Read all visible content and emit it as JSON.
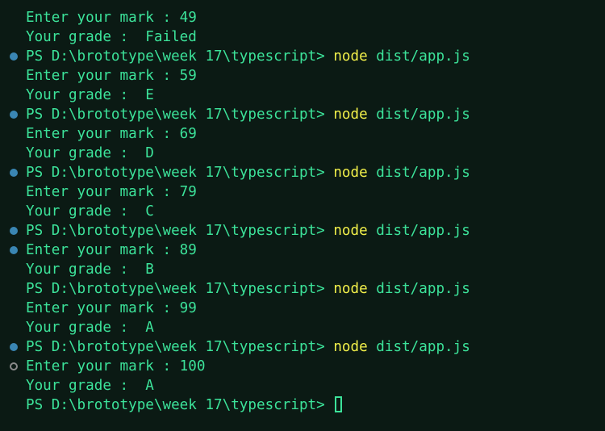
{
  "terminal": {
    "prompt": "PS D:\\brototype\\week 17\\typescript> ",
    "command": "node",
    "args": " dist/app.js",
    "lines": [
      {
        "kind": "output",
        "dot": "none",
        "text": "Enter your mark : 49"
      },
      {
        "kind": "output",
        "dot": "none",
        "text": "Your grade :  Failed"
      },
      {
        "kind": "prompt",
        "dot": "filled"
      },
      {
        "kind": "output",
        "dot": "none",
        "text": "Enter your mark : 59"
      },
      {
        "kind": "output",
        "dot": "none",
        "text": "Your grade :  E"
      },
      {
        "kind": "prompt",
        "dot": "filled"
      },
      {
        "kind": "output",
        "dot": "none",
        "text": "Enter your mark : 69"
      },
      {
        "kind": "output",
        "dot": "none",
        "text": "Your grade :  D"
      },
      {
        "kind": "prompt",
        "dot": "filled"
      },
      {
        "kind": "output",
        "dot": "none",
        "text": "Enter your mark : 79"
      },
      {
        "kind": "output",
        "dot": "none",
        "text": "Your grade :  C"
      },
      {
        "kind": "prompt",
        "dot": "filled"
      },
      {
        "kind": "output",
        "dot": "filled",
        "text": "Enter your mark : 89"
      },
      {
        "kind": "output",
        "dot": "none",
        "text": "Your grade :  B"
      },
      {
        "kind": "prompt",
        "dot": "none"
      },
      {
        "kind": "output",
        "dot": "none",
        "text": "Enter your mark : 99"
      },
      {
        "kind": "output",
        "dot": "none",
        "text": "Your grade :  A"
      },
      {
        "kind": "prompt",
        "dot": "filled"
      },
      {
        "kind": "output",
        "dot": "hollow",
        "text": "Enter your mark : 100"
      },
      {
        "kind": "output",
        "dot": "none",
        "text": "Your grade :  A"
      },
      {
        "kind": "final-prompt",
        "dot": "none"
      }
    ]
  },
  "colors": {
    "background": "#0b1a14",
    "text": "#3ce39a",
    "command": "#f2f04a",
    "decoration_success": "#3a86b3",
    "decoration_pending": "#8a8a8a"
  }
}
